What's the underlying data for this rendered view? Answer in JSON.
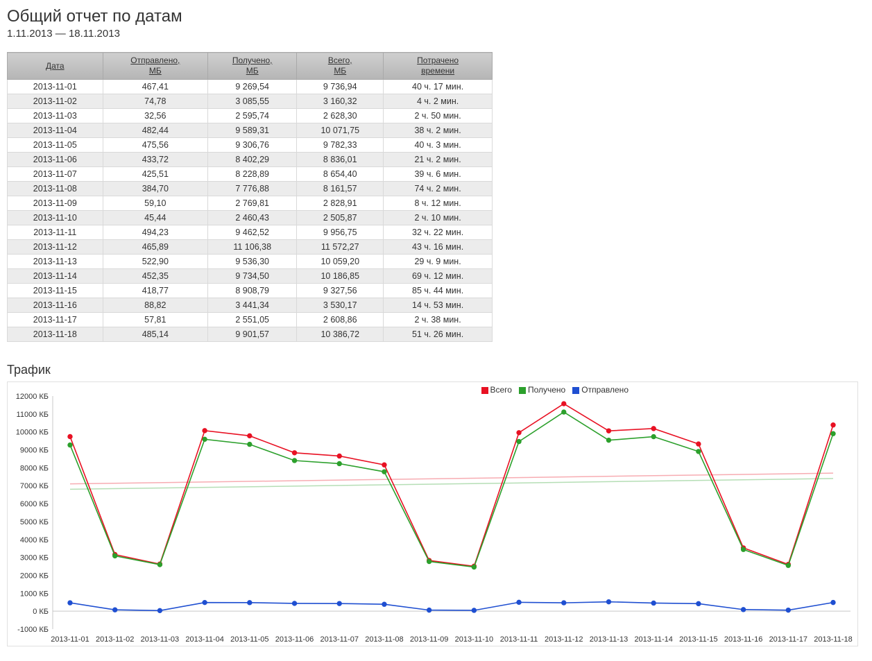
{
  "title": "Общий отчет по датам",
  "date_range": "1.11.2013 — 18.11.2013",
  "table": {
    "headers": [
      "Дата",
      "Отправлено,\nМБ",
      "Получено,\nМБ",
      "Всего,\nМБ",
      "Потрачено\nвремени"
    ],
    "rows": [
      [
        "2013-11-01",
        "467,41",
        "9 269,54",
        "9 736,94",
        "40 ч. 17 мин."
      ],
      [
        "2013-11-02",
        "74,78",
        "3 085,55",
        "3 160,32",
        "4 ч. 2 мин."
      ],
      [
        "2013-11-03",
        "32,56",
        "2 595,74",
        "2 628,30",
        "2 ч. 50 мин."
      ],
      [
        "2013-11-04",
        "482,44",
        "9 589,31",
        "10 071,75",
        "38 ч. 2 мин."
      ],
      [
        "2013-11-05",
        "475,56",
        "9 306,76",
        "9 782,33",
        "40 ч. 3 мин."
      ],
      [
        "2013-11-06",
        "433,72",
        "8 402,29",
        "8 836,01",
        "21 ч. 2 мин."
      ],
      [
        "2013-11-07",
        "425,51",
        "8 228,89",
        "8 654,40",
        "39 ч. 6 мин."
      ],
      [
        "2013-11-08",
        "384,70",
        "7 776,88",
        "8 161,57",
        "74 ч. 2 мин."
      ],
      [
        "2013-11-09",
        "59,10",
        "2 769,81",
        "2 828,91",
        "8 ч. 12 мин."
      ],
      [
        "2013-11-10",
        "45,44",
        "2 460,43",
        "2 505,87",
        "2 ч. 10 мин."
      ],
      [
        "2013-11-11",
        "494,23",
        "9 462,52",
        "9 956,75",
        "32 ч. 22 мин."
      ],
      [
        "2013-11-12",
        "465,89",
        "11 106,38",
        "11 572,27",
        "43 ч. 16 мин."
      ],
      [
        "2013-11-13",
        "522,90",
        "9 536,30",
        "10 059,20",
        "29 ч. 9 мин."
      ],
      [
        "2013-11-14",
        "452,35",
        "9 734,50",
        "10 186,85",
        "69 ч. 12 мин."
      ],
      [
        "2013-11-15",
        "418,77",
        "8 908,79",
        "9 327,56",
        "85 ч. 44 мин."
      ],
      [
        "2013-11-16",
        "88,82",
        "3 441,34",
        "3 530,17",
        "14 ч. 53 мин."
      ],
      [
        "2013-11-17",
        "57,81",
        "2 551,05",
        "2 608,86",
        "2 ч. 38 мин."
      ],
      [
        "2013-11-18",
        "485,14",
        "9 901,57",
        "10 386,72",
        "51 ч. 26 мин."
      ]
    ]
  },
  "chart_title": "Трафик",
  "legend": {
    "total": "Всего",
    "received": "Получено",
    "sent": "Отправлено"
  },
  "y_unit": "КБ",
  "chart_data": {
    "type": "line",
    "title": "Трафик",
    "xlabel": "",
    "ylabel": "КБ",
    "ylim": [
      -1000,
      12000
    ],
    "yticks": [
      -1000,
      0,
      1000,
      2000,
      3000,
      4000,
      5000,
      6000,
      7000,
      8000,
      9000,
      10000,
      11000,
      12000
    ],
    "categories": [
      "2013-11-01",
      "2013-11-02",
      "2013-11-03",
      "2013-11-04",
      "2013-11-05",
      "2013-11-06",
      "2013-11-07",
      "2013-11-08",
      "2013-11-09",
      "2013-11-10",
      "2013-11-11",
      "2013-11-12",
      "2013-11-13",
      "2013-11-14",
      "2013-11-15",
      "2013-11-16",
      "2013-11-17",
      "2013-11-18"
    ],
    "series": [
      {
        "name": "Всего",
        "color": "#e81123",
        "values": [
          9736.94,
          3160.32,
          2628.3,
          10071.75,
          9782.33,
          8836.01,
          8654.4,
          8161.57,
          2828.91,
          2505.87,
          9956.75,
          11572.27,
          10059.2,
          10186.85,
          9327.56,
          3530.17,
          2608.86,
          10386.72
        ]
      },
      {
        "name": "Получено",
        "color": "#2ca02c",
        "values": [
          9269.54,
          3085.55,
          2595.74,
          9589.31,
          9306.76,
          8402.29,
          8228.89,
          7776.88,
          2769.81,
          2460.43,
          9462.52,
          11106.38,
          9536.3,
          9734.5,
          8908.79,
          3441.34,
          2551.05,
          9901.57
        ]
      },
      {
        "name": "Отправлено",
        "color": "#1f4fd1",
        "values": [
          467.41,
          74.78,
          32.56,
          482.44,
          475.56,
          433.72,
          425.51,
          384.7,
          59.1,
          45.44,
          494.23,
          465.89,
          522.9,
          452.35,
          418.77,
          88.82,
          57.81,
          485.14
        ]
      }
    ],
    "trend_lines": [
      {
        "name": "Всего (тренд)",
        "color": "rgba(232,17,35,0.35)",
        "start": 7100,
        "end": 7700
      },
      {
        "name": "Получено (тренд)",
        "color": "rgba(44,160,44,0.35)",
        "start": 6800,
        "end": 7400
      }
    ]
  }
}
